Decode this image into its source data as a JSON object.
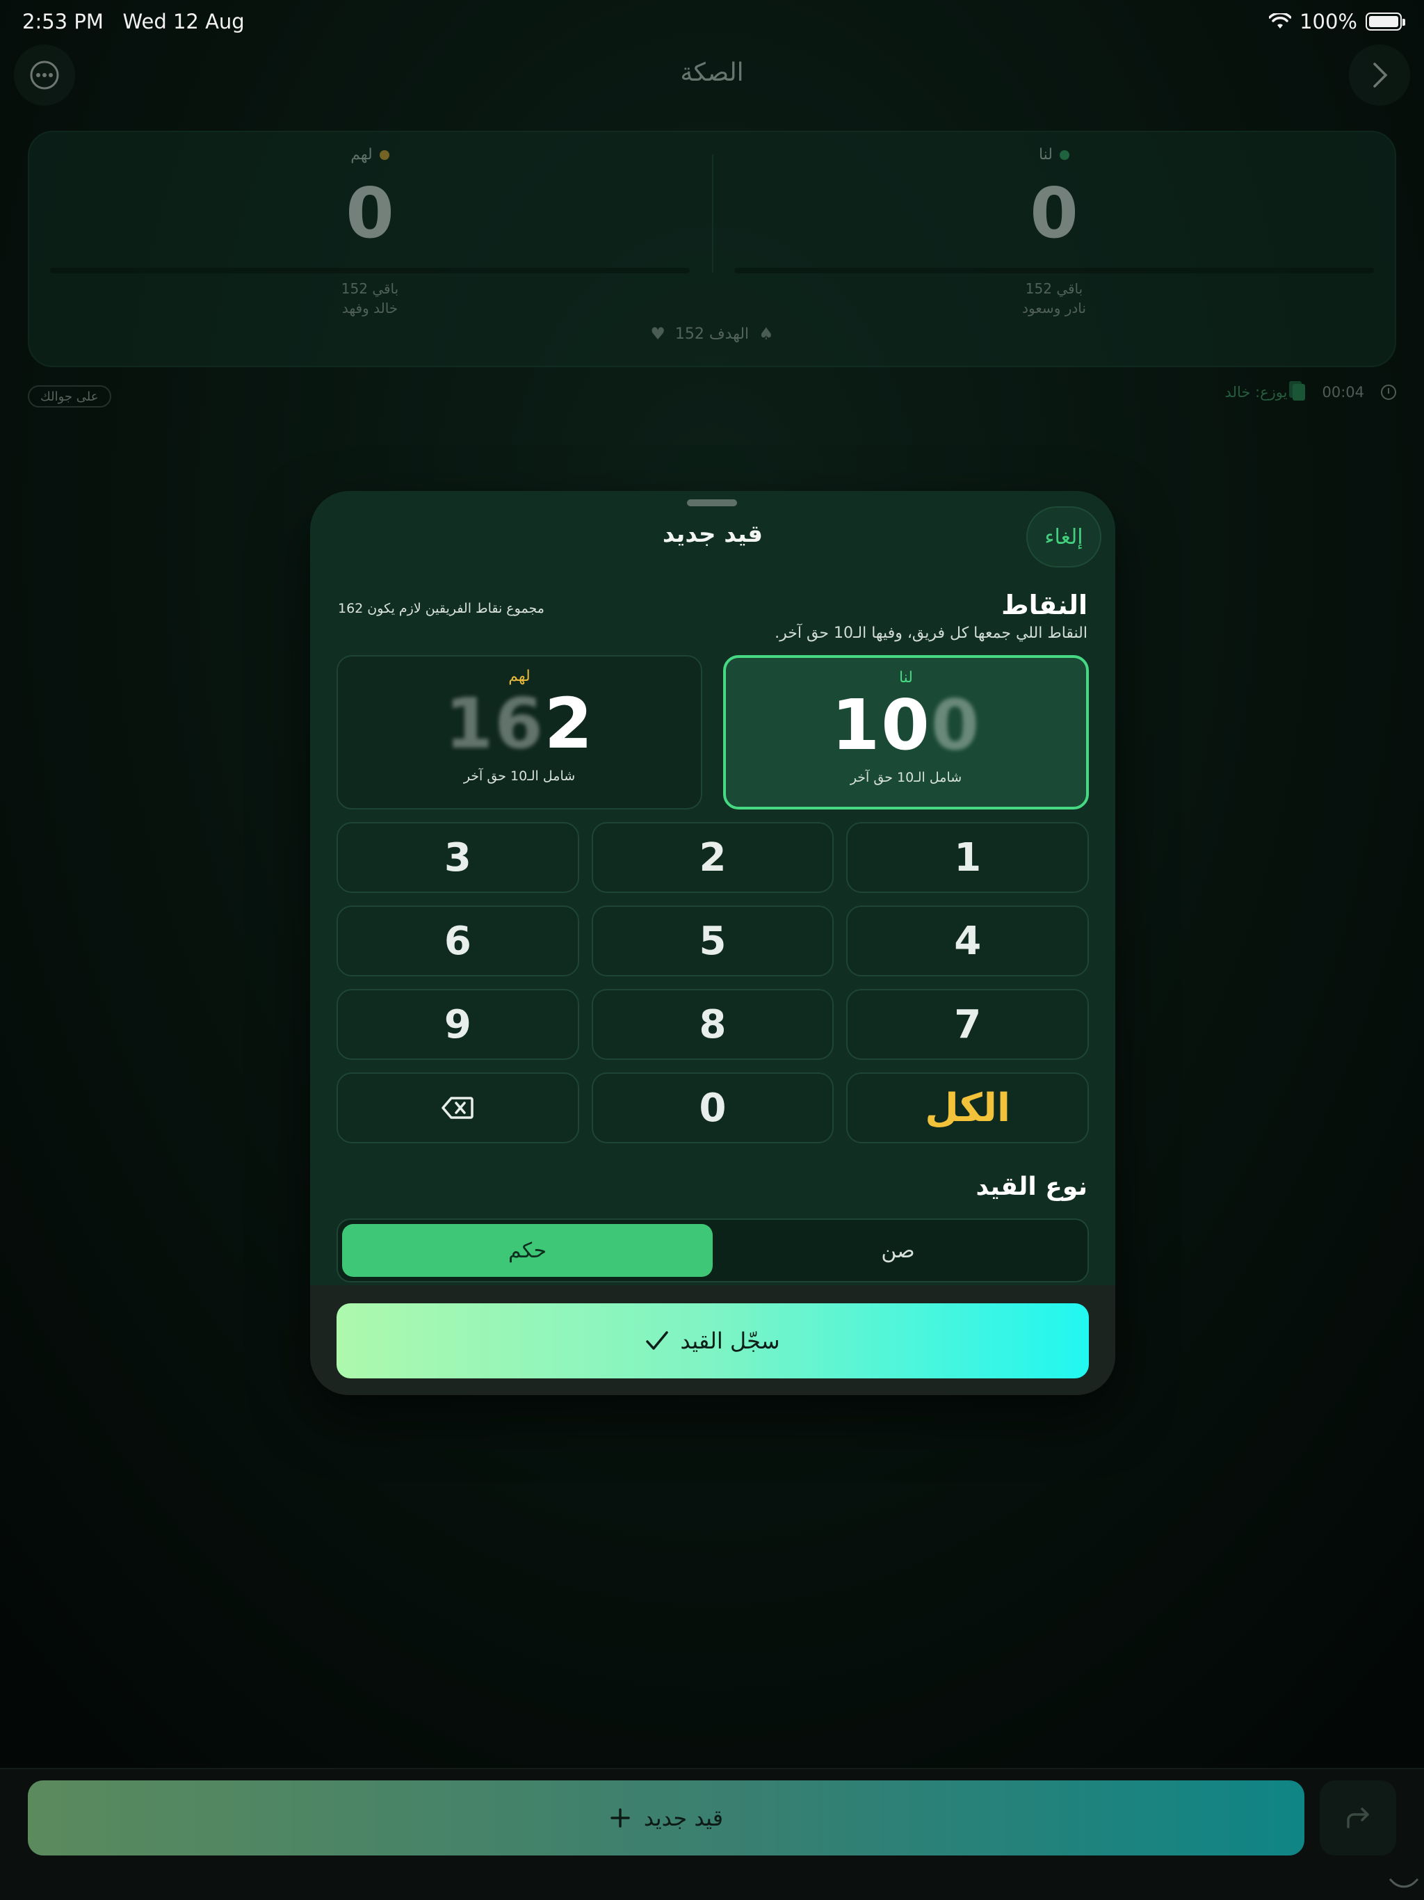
{
  "status_bar": {
    "time": "2:53 PM",
    "date": "Wed 12 Aug",
    "battery": "100%"
  },
  "nav": {
    "title": "الصكة"
  },
  "scoreboard": {
    "us": {
      "label": "لنا",
      "score": "0",
      "remaining": "باقي 152",
      "players": "نادر وسعود",
      "dot_color": "#2f9a5c"
    },
    "them": {
      "label": "لهم",
      "score": "0",
      "remaining": "باقي 152",
      "players": "خالد وفهد",
      "dot_color": "#c99a2e"
    },
    "goal": "الهدف 152"
  },
  "meta": {
    "on_phone": "على جوالك",
    "timer": "00:04",
    "dealer": "يوزع: خالد"
  },
  "sheet": {
    "title": "قيد جديد",
    "cancel": "إلغاء",
    "points_title": "النقاط",
    "points_subtitle": "النقاط اللي جمعها كل فريق، وفيها الـ10 حق آخر.",
    "points_rule": "مجموع نقاط الفريقين لازم يكون 162",
    "them_box": {
      "label": "لهم",
      "ghost": "16",
      "value": "2",
      "note": "شامل الـ10 حق آخر"
    },
    "us_box": {
      "label": "لنا",
      "value": "10",
      "ghost": "0",
      "note": "شامل الـ10 حق آخر"
    },
    "keypad": {
      "k1": "1",
      "k2": "2",
      "k3": "3",
      "k4": "4",
      "k5": "5",
      "k6": "6",
      "k7": "7",
      "k8": "8",
      "k9": "9",
      "all": "الكل",
      "k0": "0"
    },
    "type_title": "نوع القيد",
    "type_options": {
      "sun": "صن",
      "hokm": "حكم"
    },
    "save": "سجّل القيد"
  },
  "bottom": {
    "new_entry": "قيد جديد"
  },
  "colors": {
    "accent_green": "#46d883",
    "gold": "#f2c23b",
    "cyan": "#21f7f0"
  }
}
